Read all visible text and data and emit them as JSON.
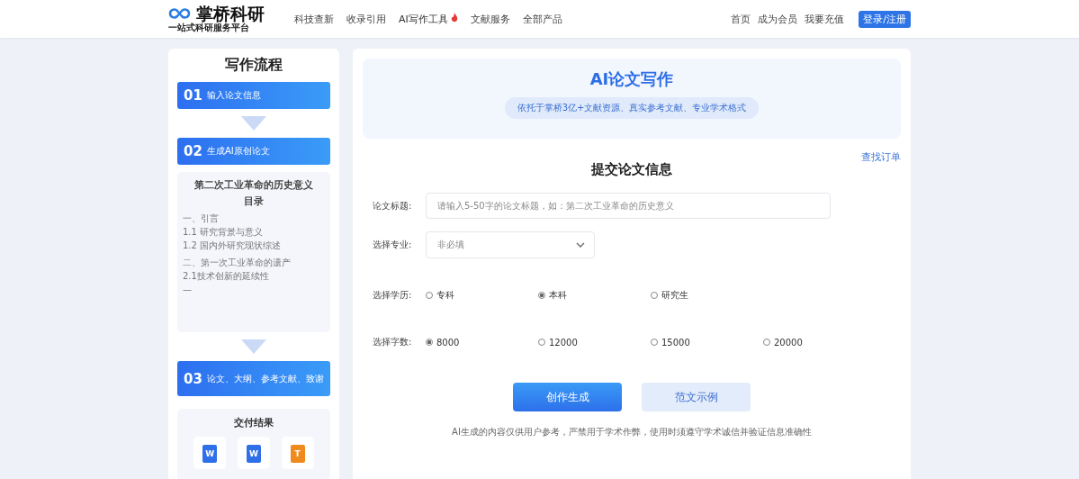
{
  "header": {
    "logo": "掌桥科研",
    "slogan": "一站式科研服务平台",
    "nav": [
      {
        "label": "科技查新",
        "hot": false
      },
      {
        "label": "收录引用",
        "hot": false
      },
      {
        "label": "AI写作工具",
        "hot": true
      },
      {
        "label": "文献服务",
        "hot": false
      },
      {
        "label": "全部产品",
        "hot": false
      }
    ],
    "links": [
      "首页",
      "成为会员",
      "我要充值"
    ],
    "login_button": "登录/注册"
  },
  "sidebar": {
    "title": "写作流程",
    "steps": [
      {
        "number": "01",
        "label": "输入论文信息"
      },
      {
        "number": "02",
        "label": "生成AI原创论文"
      }
    ],
    "outline": {
      "title": "第二次工业革命的历史意义",
      "heading": "目录",
      "groups": [
        [
          "一、引言",
          "1.1 研究背景与意义",
          "1.2 国内外研究现状综述"
        ],
        [
          "二、第一次工业革命的遗产",
          "2.1技术创新的延续性",
          "—"
        ]
      ]
    },
    "final_step": {
      "number": "03",
      "label": "论文、大纲、参考文献、致谢"
    },
    "delivery": {
      "title": "交付结果",
      "files": [
        {
          "letter": "W",
          "color": "#2f6fe8"
        },
        {
          "letter": "W",
          "color": "#2f6fe8"
        },
        {
          "letter": "T",
          "color": "#f08a1c"
        }
      ]
    }
  },
  "main": {
    "hero": {
      "title": "AI论文写作",
      "subtitle": "依托于掌桥3亿+文献资源、真实参考文献、专业学术格式"
    },
    "order_link": "查找订单",
    "form_title": "提交论文信息",
    "title_field": {
      "label": "论文标题:",
      "placeholder": "请输入5-50字的论文标题，如：第二次工业革命的历史意义"
    },
    "major_field": {
      "label": "选择专业:",
      "placeholder": "非必填"
    },
    "radio_groups": [
      {
        "label": "选择学历:",
        "options": [
          {
            "label": "专科",
            "selected": false
          },
          {
            "label": "本科",
            "selected": true
          },
          {
            "label": "研究生",
            "selected": false
          }
        ]
      },
      {
        "label": "选择字数:",
        "options": [
          {
            "label": "8000",
            "selected": true
          },
          {
            "label": "12000",
            "selected": false
          },
          {
            "label": "15000",
            "selected": false
          },
          {
            "label": "20000",
            "selected": false
          }
        ]
      }
    ],
    "buttons": [
      {
        "label": "创作生成",
        "kind": "primary"
      },
      {
        "label": "范文示例",
        "kind": "secondary"
      }
    ],
    "disclaimer": "AI生成的内容仅供用户参考，严禁用于学术作弊，使用时须遵守学术诚信并验证信息准确性"
  }
}
